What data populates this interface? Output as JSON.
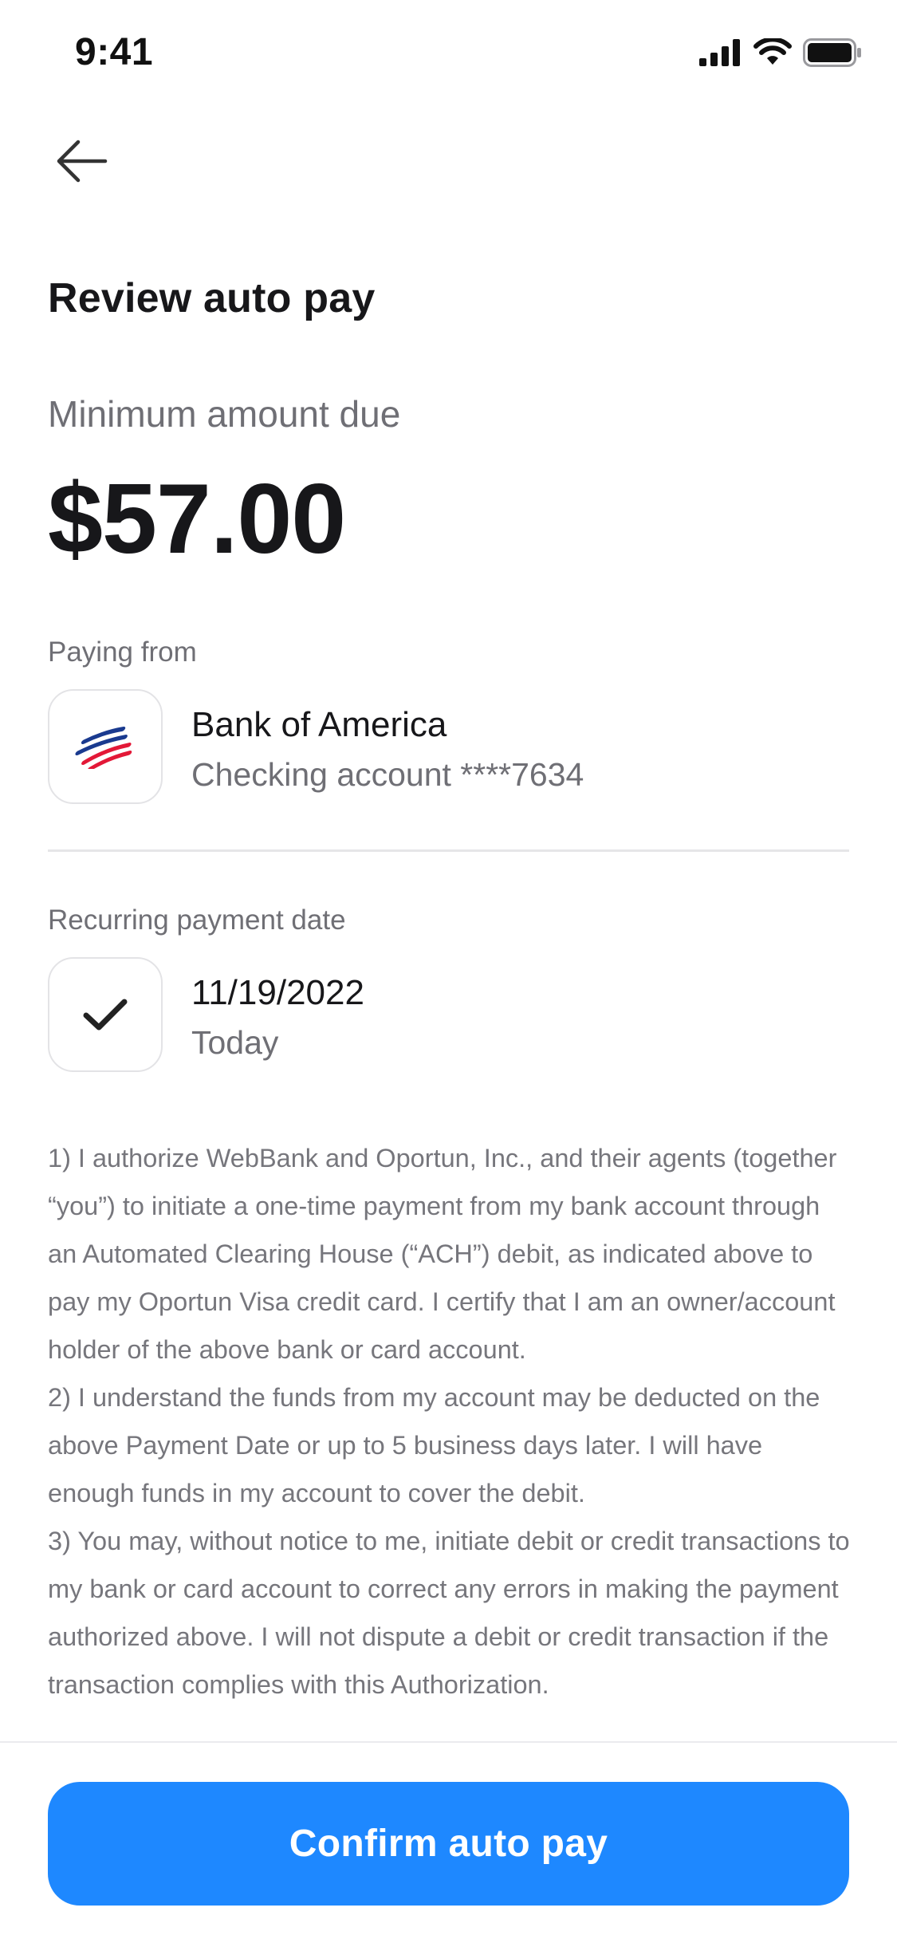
{
  "status_bar": {
    "time": "9:41",
    "icons": [
      "cellular-signal-icon",
      "wifi-icon",
      "battery-icon"
    ]
  },
  "header": {
    "back_icon": "arrow-left-icon",
    "title": "Review auto pay"
  },
  "amount": {
    "label": "Minimum amount due",
    "value": "$57.00"
  },
  "paying_from": {
    "label": "Paying from",
    "bank_logo": "bank-of-america-logo",
    "bank_name": "Bank of America",
    "account": "Checking account ****7634"
  },
  "recurring": {
    "label": "Recurring payment date",
    "icon": "checkmark-icon",
    "date": "11/19/2022",
    "relative": "Today"
  },
  "legal": {
    "paragraph1": "1) I authorize WebBank and Oportun, Inc., and their agents (together “you”) to initiate a one-time payment from my bank account through an Automated Clearing House (“ACH”) debit, as indicated above to pay my Oportun Visa credit card. I certify that I am an owner/account holder of the above bank or card account.",
    "paragraph2": "2) I understand the funds from my account may be deducted on the above Payment Date or up to 5 business days later. I will have enough funds in my account to cover the debit.",
    "paragraph3": "3) You may, without notice to me, initiate debit or credit transactions to my bank or card account to correct any errors in making the payment authorized above. I will not dispute a debit or credit transaction if the transaction complies with this Authorization."
  },
  "footer": {
    "confirm_label": "Confirm auto pay"
  },
  "colors": {
    "primary": "#1e88ff",
    "text": "#17171a",
    "muted": "#6f6f75"
  }
}
